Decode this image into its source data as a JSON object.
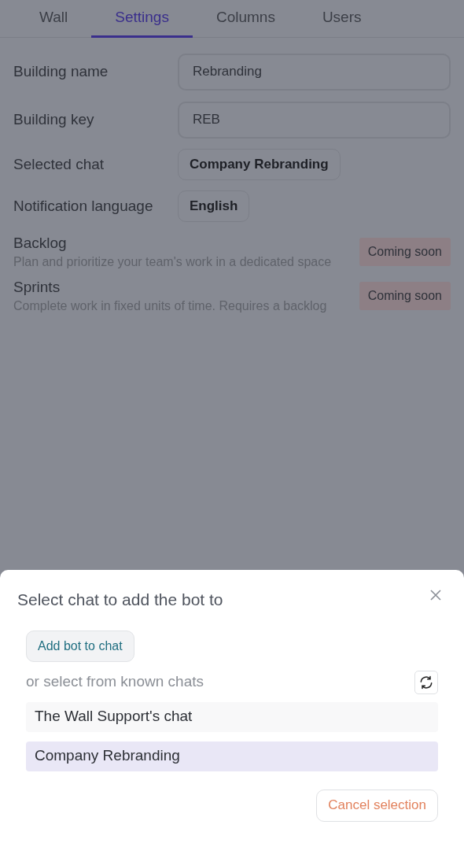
{
  "tabs": [
    {
      "label": "Wall",
      "selected": false
    },
    {
      "label": "Settings",
      "selected": true
    },
    {
      "label": "Columns",
      "selected": false
    },
    {
      "label": "Users",
      "selected": false
    }
  ],
  "fields": [
    {
      "label": "Building name",
      "value": "Rebranding"
    },
    {
      "label": "Building key",
      "value": "REB"
    }
  ],
  "pickers": [
    {
      "label": "Selected chat",
      "value": "Company Rebranding"
    },
    {
      "label": "Notification language",
      "value": "English"
    }
  ],
  "features": [
    {
      "title": "Backlog",
      "description": "Plan and prioritize your team's work in a dedicated space",
      "badge": "Coming soon"
    },
    {
      "title": "Sprints",
      "description": "Complete work in fixed units of time. Requires a backlog",
      "badge": "Coming soon"
    }
  ],
  "sheet": {
    "title": "Select chat to add the bot to",
    "add_button": "Add bot to chat",
    "hint": "or select from known chats",
    "chats": [
      {
        "name": "The Wall Support's chat",
        "selected": false
      },
      {
        "name": "Company Rebranding",
        "selected": true
      }
    ],
    "cancel_button": "Cancel selection"
  }
}
